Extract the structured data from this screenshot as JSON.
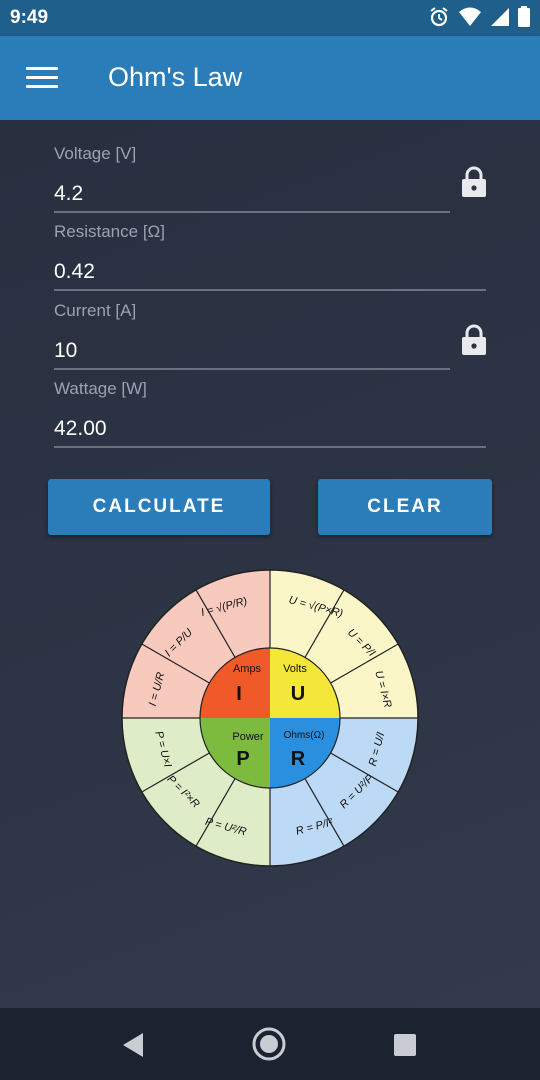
{
  "status": {
    "time": "9:49"
  },
  "appbar": {
    "title": "Ohm's Law"
  },
  "fields": [
    {
      "label": "Voltage [V]",
      "value": "4.2",
      "locked": true
    },
    {
      "label": "Resistance [Ω]",
      "value": "0.42",
      "locked": false
    },
    {
      "label": "Current [A]",
      "value": "10",
      "locked": true
    },
    {
      "label": "Wattage [W]",
      "value": "42.00",
      "locked": false
    }
  ],
  "buttons": {
    "calculate": "CALCULATE",
    "clear": "CLEAR"
  },
  "wheel": {
    "quadrants": [
      {
        "caption": "Amps",
        "letter": "I",
        "color": "#f05a28"
      },
      {
        "caption": "Volts",
        "letter": "U",
        "color": "#f5e63a"
      },
      {
        "caption": "Power",
        "letter": "P",
        "color": "#7cbb3e"
      },
      {
        "caption": "Ohms(Ω)",
        "letter": "R",
        "color": "#2b8fe0"
      }
    ],
    "formulas": {
      "amps": [
        "I = √(P/R)",
        "I = P/U",
        "I = U/R"
      ],
      "volts": [
        "U = √(P×R)",
        "U = P/I",
        "U = I×R"
      ],
      "ohms": [
        "R = U/I",
        "R = U²/P",
        "R = P/I²"
      ],
      "power": [
        "P = U²/R",
        "P = I²×R",
        "P = U×I"
      ]
    },
    "colors": {
      "amps_outer": "#f8c9bd",
      "volts_outer": "#fbf6c8",
      "ohms_outer": "#bcd9f5",
      "power_outer": "#dfecc8"
    }
  },
  "icons": {
    "menu": "menu-icon",
    "lock": "lock-icon",
    "alarm": "alarm-icon",
    "wifi": "wifi-icon",
    "signal": "signal-icon",
    "battery": "battery-icon",
    "back": "back-icon",
    "home": "home-icon",
    "recents": "recents-icon"
  }
}
